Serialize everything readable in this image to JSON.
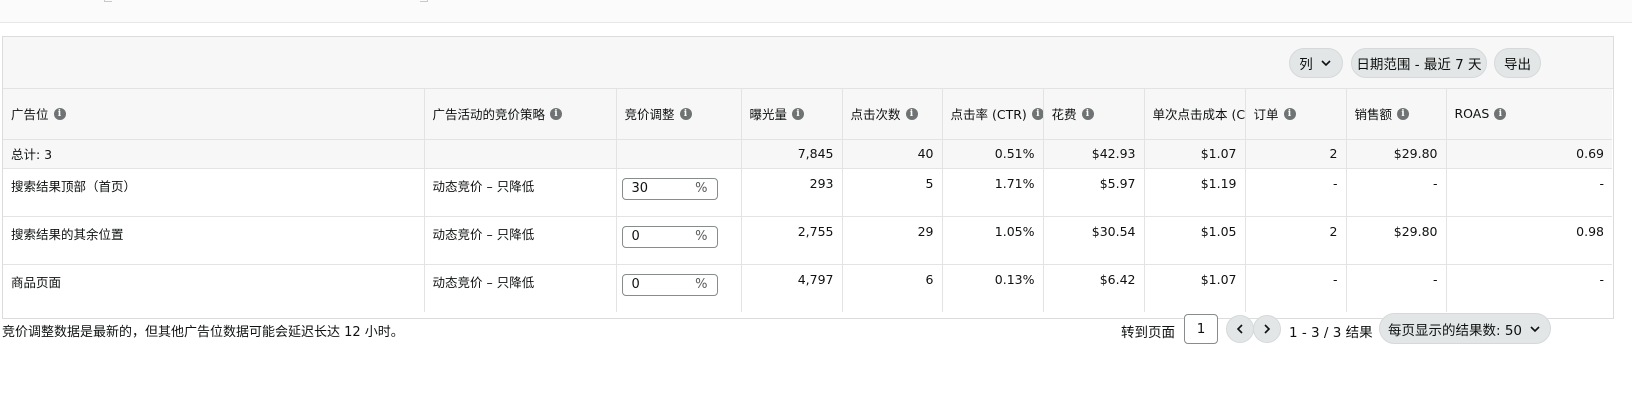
{
  "toolbar": {
    "columns_label": "列",
    "date_range_label": "日期范围 - 最近 7 天",
    "export_label": "导出"
  },
  "table": {
    "headers": [
      "广告位",
      "广告活动的竞价策略",
      "竞价调整",
      "曝光量",
      "点击次数",
      "点击率 (CTR)",
      "花费",
      "单次点击成本 (CPC)",
      "订单",
      "销售额",
      "ROAS"
    ],
    "total": {
      "label": "总计: 3",
      "impressions": "7,845",
      "clicks": "40",
      "ctr": "0.51%",
      "spend": "$42.93",
      "cpc": "$1.07",
      "orders": "2",
      "sales": "$29.80",
      "roas": "0.69"
    },
    "rows": [
      {
        "placement": "搜索结果顶部（首页）",
        "strategy": "动态竞价 – 只降低",
        "bid_adjust": "30",
        "impressions": "293",
        "clicks": "5",
        "ctr": "1.71%",
        "spend": "$5.97",
        "cpc": "$1.19",
        "orders": "-",
        "sales": "-",
        "roas": "-"
      },
      {
        "placement": "搜索结果的其余位置",
        "strategy": "动态竞价 – 只降低",
        "bid_adjust": "0",
        "impressions": "2,755",
        "clicks": "29",
        "ctr": "1.05%",
        "spend": "$30.54",
        "cpc": "$1.05",
        "orders": "2",
        "sales": "$29.80",
        "roas": "0.98"
      },
      {
        "placement": "商品页面",
        "strategy": "动态竞价 – 只降低",
        "bid_adjust": "0",
        "impressions": "4,797",
        "clicks": "6",
        "ctr": "0.13%",
        "spend": "$6.42",
        "cpc": "$1.07",
        "orders": "-",
        "sales": "-",
        "roas": "-"
      }
    ],
    "percent_symbol": "%",
    "info_glyph": "i"
  },
  "footer": {
    "note": "竞价调整数据是最新的，但其他广告位数据可能会延迟长达 12 小时。",
    "goto_label": "转到页面",
    "page_value": "1",
    "range_text": "1 - 3 / 3 结果",
    "per_page_label": "每页显示的结果数:  50"
  },
  "icons": {
    "info": "info-circle-icon",
    "chevron_down": "chevron-down-icon",
    "chevron_left": "chevron-left-icon",
    "chevron_right": "chevron-right-icon"
  },
  "colors": {
    "header_bg": "#f7f7f7",
    "button_bg": "#e3e6e6",
    "border": "#e3e3e3",
    "text": "#0f1111"
  }
}
